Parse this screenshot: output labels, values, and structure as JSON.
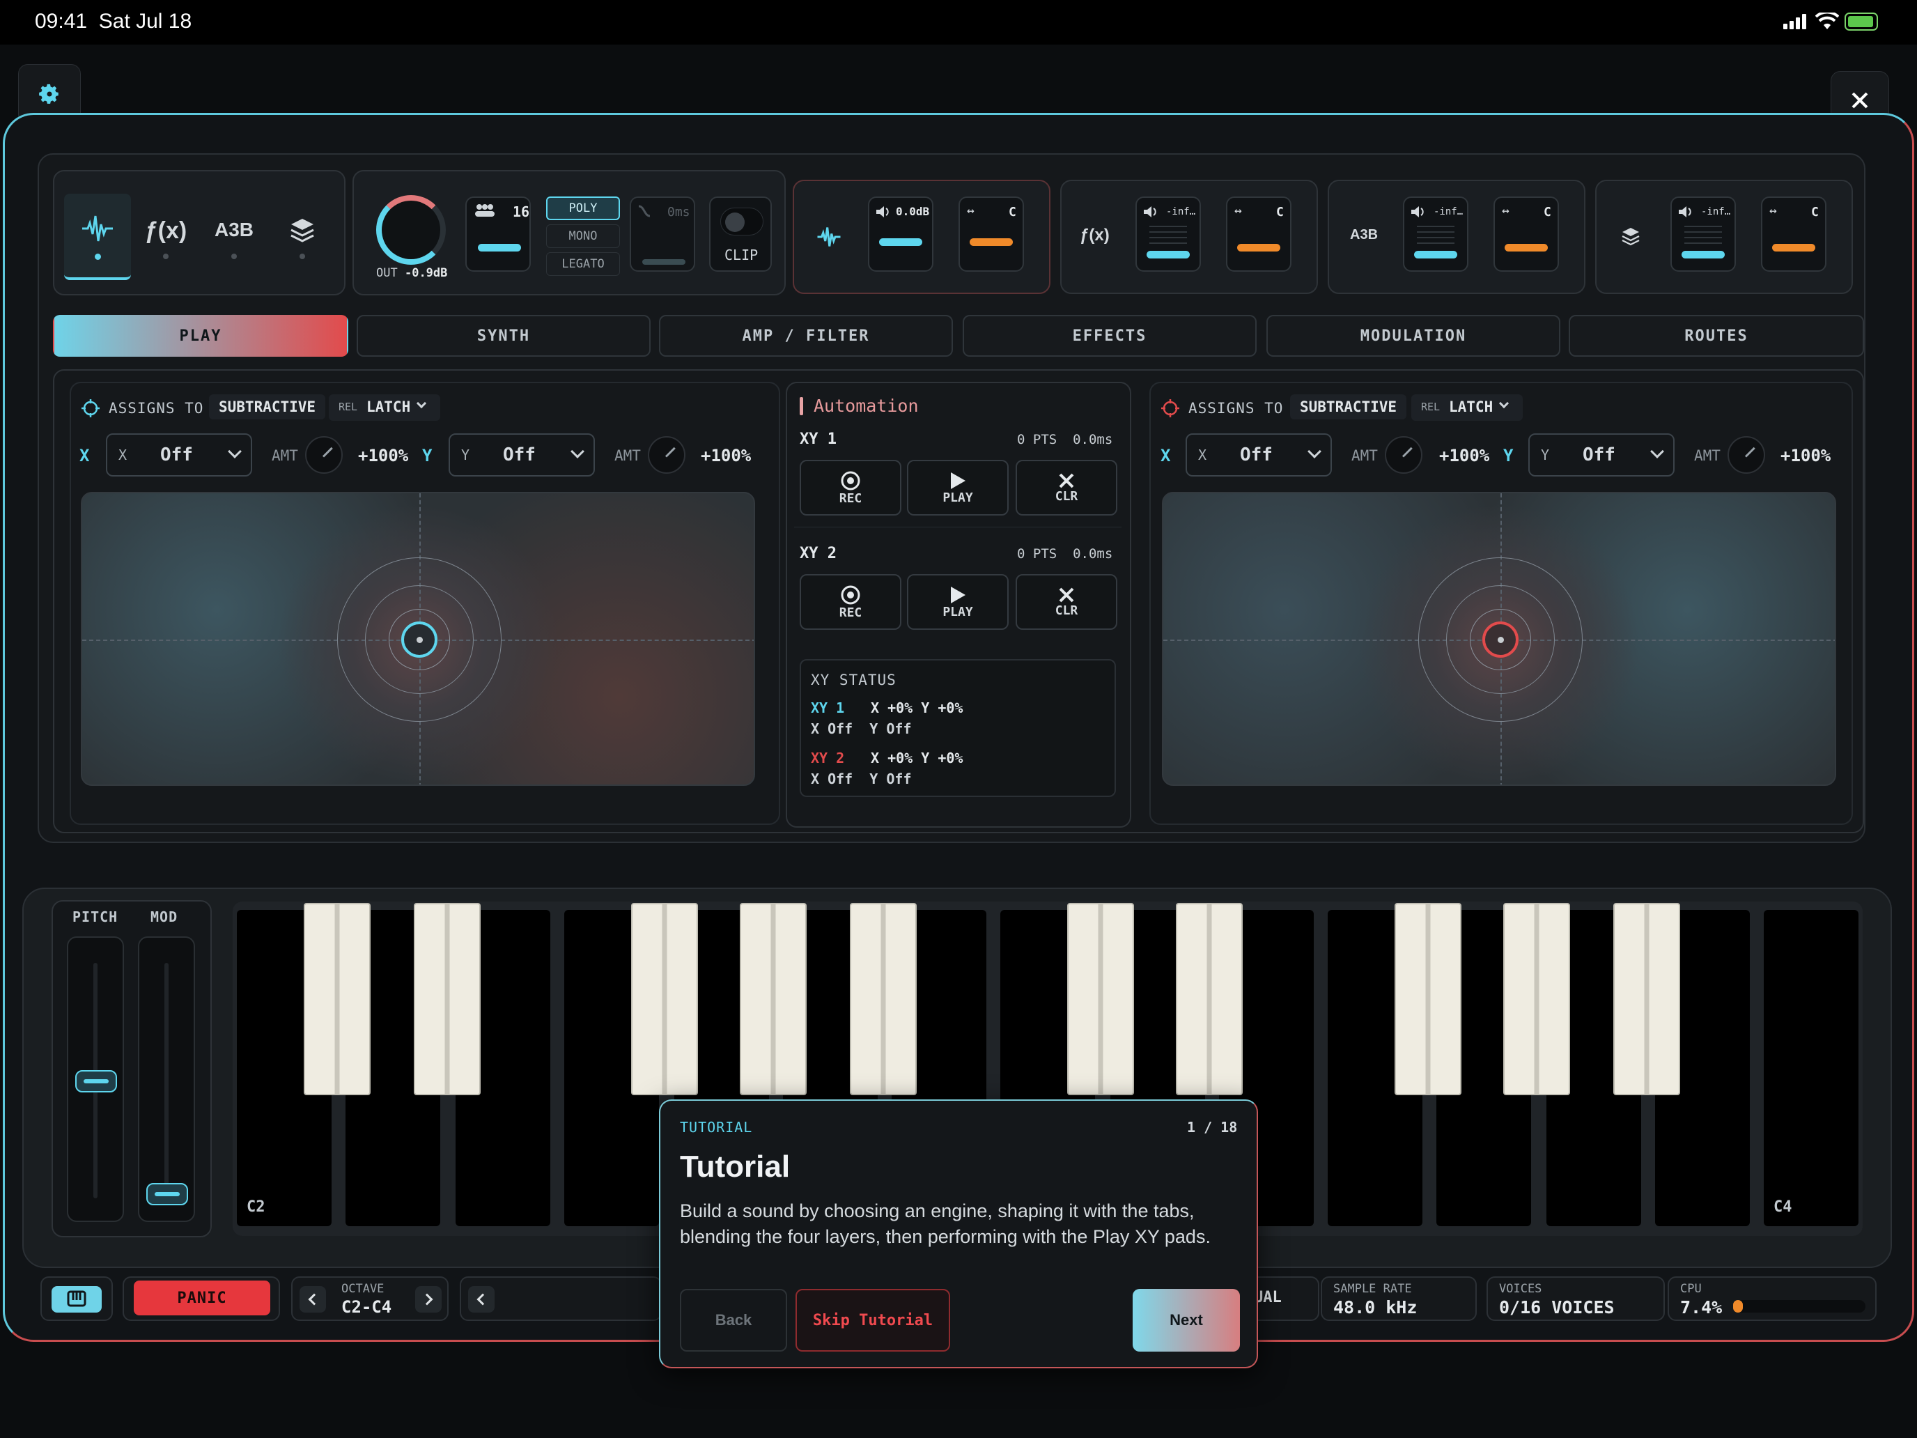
{
  "status_bar": {
    "time": "09:41",
    "date": "Sat Jul 18"
  },
  "header": {
    "settings_icon": "gear-icon",
    "close_icon": "close-icon"
  },
  "engines": {
    "items": [
      {
        "icon": "waveform-icon"
      },
      {
        "label": "ƒ(x)"
      },
      {
        "label": "A3B"
      },
      {
        "icon": "layers-icon"
      }
    ]
  },
  "output": {
    "knob_label": "OUT",
    "knob_value": "-0.9dB",
    "voices": "16",
    "modes": [
      "POLY",
      "MONO",
      "LEGATO"
    ],
    "glide": "0ms",
    "clip": "CLIP"
  },
  "layers": [
    {
      "icon": "waveform-icon",
      "gain": "0.0dB",
      "pan": "C"
    },
    {
      "label": "ƒ(x)",
      "gain": "-inf…",
      "pan": "C"
    },
    {
      "label": "A3B",
      "gain": "-inf…",
      "pan": "C"
    },
    {
      "icon": "layers-icon",
      "gain": "-inf…",
      "pan": "C"
    }
  ],
  "tabs": [
    "PLAY",
    "SYNTH",
    "AMP / FILTER",
    "EFFECTS",
    "MODULATION",
    "ROUTES"
  ],
  "xy_left": {
    "assigns": "ASSIGNS TO",
    "target": "SUBTRACTIVE",
    "rel": "REL",
    "latch": "LATCH",
    "x_axis": "X",
    "x_label": "X",
    "x_value": "Off",
    "amt": "AMT",
    "x_amt": "+100%",
    "y_axis": "Y",
    "y_label": "Y",
    "y_value": "Off",
    "y_amt": "+100%"
  },
  "xy_right": {
    "assigns": "ASSIGNS TO",
    "target": "SUBTRACTIVE",
    "rel": "REL",
    "latch": "LATCH",
    "x_axis": "X",
    "x_label": "X",
    "x_value": "Off",
    "amt": "AMT",
    "x_amt": "+100%",
    "y_axis": "Y",
    "y_label": "Y",
    "y_value": "Off",
    "y_amt": "+100%"
  },
  "automation": {
    "title": "Automation",
    "xy1": {
      "name": "XY 1",
      "pts": "0 PTS",
      "time": "0.0ms"
    },
    "xy2": {
      "name": "XY 2",
      "pts": "0 PTS",
      "time": "0.0ms"
    },
    "rec": "REC",
    "play": "PLAY",
    "clr": "CLR",
    "status": {
      "title": "XY STATUS",
      "xy1": "XY 1",
      "xy1_xy": "X +0% Y +0%",
      "xy1_map": "X Off  Y Off",
      "xy2": "XY 2",
      "xy2_xy": "X +0% Y +0%",
      "xy2_map": "X Off  Y Off"
    }
  },
  "wheels": {
    "pitch": "PITCH",
    "mod": "MOD",
    "pitch_value": 0.5,
    "mod_value": 0.0
  },
  "keyboard": {
    "low_label": "C2",
    "high_label": "C4"
  },
  "bottom": {
    "panic": "PANIC",
    "octave_label": "OCTAVE",
    "octave_value": "C2-C4",
    "partial": "UAL",
    "sample_rate_label": "SAMPLE RATE",
    "sample_rate": "48.0 kHz",
    "voices_label": "VOICES",
    "voices": "0/16 VOICES",
    "cpu_label": "CPU",
    "cpu": "7.4%",
    "cpu_value": 0.074
  },
  "tutorial": {
    "tag": "TUTORIAL",
    "step": "1 / 18",
    "title": "Tutorial",
    "body": "Build a sound by choosing an engine, shaping it with the tabs, blending the four layers, then performing with the Play XY pads.",
    "back": "Back",
    "skip": "Skip Tutorial",
    "next": "Next"
  },
  "colors": {
    "cyan": "#5ed6ee",
    "red": "#e24b4c",
    "orange": "#f08a2a"
  }
}
